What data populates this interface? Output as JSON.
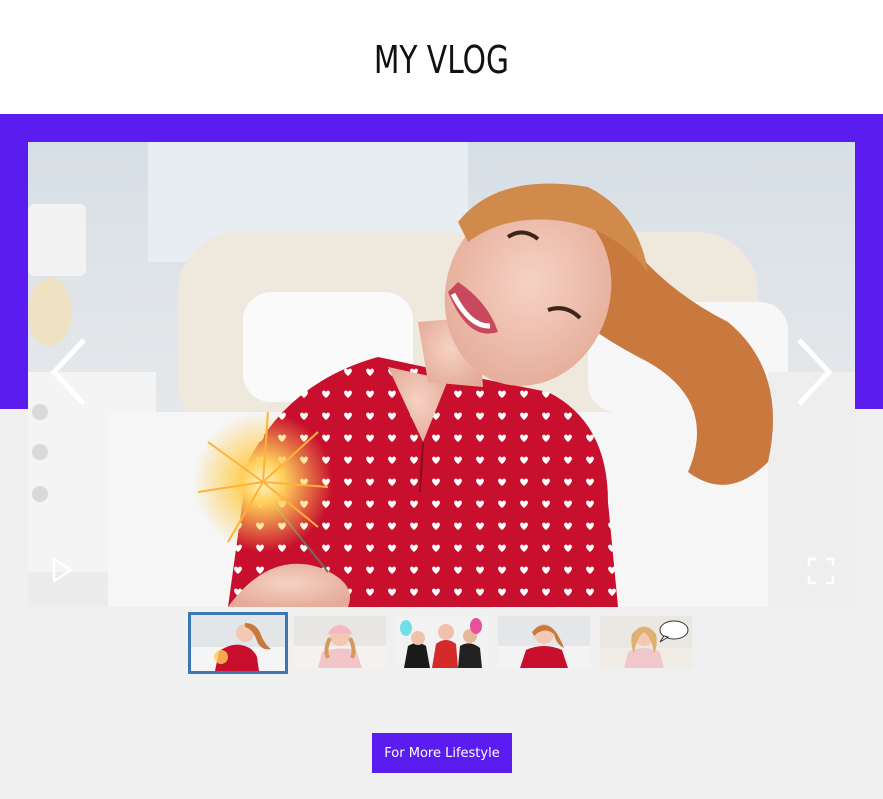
{
  "page": {
    "title": "MY VLOG"
  },
  "slider": {
    "current_slide": 1,
    "slide_count": 5,
    "prev_icon": "chevron-left-icon",
    "next_icon": "chevron-right-icon",
    "play_icon": "play-icon",
    "fullscreen_icon": "fullscreen-icon"
  },
  "thumbnails": [
    {
      "subject": "woman in red pajamas with sparkler",
      "active": true
    },
    {
      "subject": "woman in pink sleep mask on bed",
      "active": false
    },
    {
      "subject": "group in party costumes",
      "active": false
    },
    {
      "subject": "woman in red pajamas smiling",
      "active": false
    },
    {
      "subject": "woman with speech bubble",
      "active": false
    }
  ],
  "cta": {
    "label": "For More Lifestyle"
  },
  "colors": {
    "accent": "#5b1cf0",
    "background": "#f1f0f0",
    "header_bg": "#ffffff",
    "active_thumb_border": "#3a78b4"
  }
}
